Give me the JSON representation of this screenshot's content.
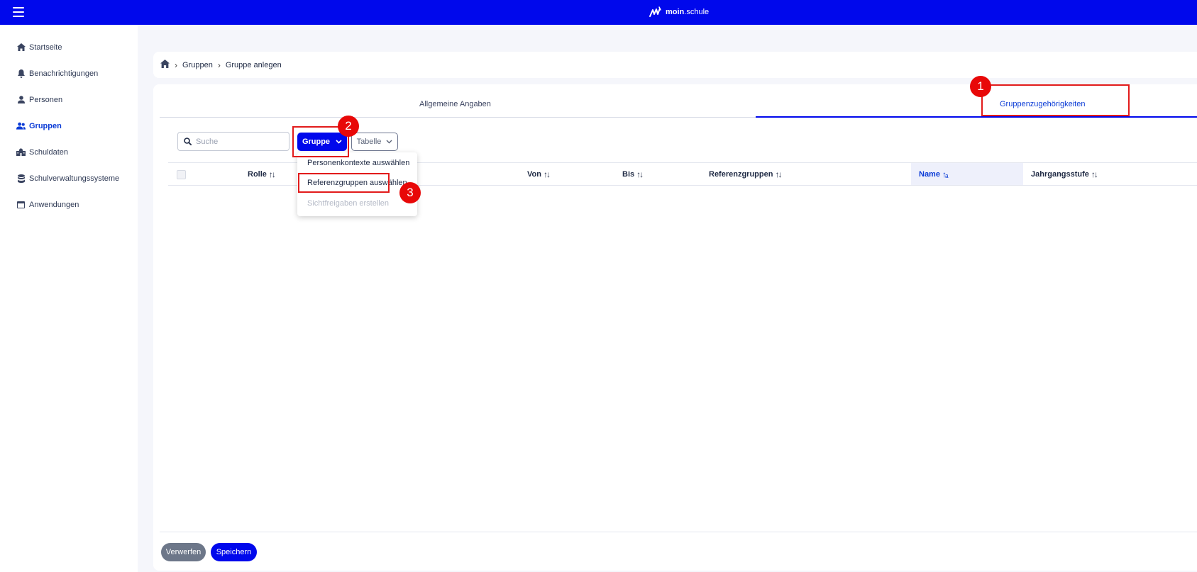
{
  "header": {
    "brand_bold": "moin",
    "brand_rest": ".schule"
  },
  "sidebar": {
    "items": [
      {
        "label": "Startseite",
        "icon": "home-icon"
      },
      {
        "label": "Benachrichtigungen",
        "icon": "bell-icon"
      },
      {
        "label": "Personen",
        "icon": "person-icon"
      },
      {
        "label": "Gruppen",
        "icon": "group-icon",
        "active": true
      },
      {
        "label": "Schuldaten",
        "icon": "school-icon"
      },
      {
        "label": "Schulverwaltungssysteme",
        "icon": "database-icon"
      },
      {
        "label": "Anwendungen",
        "icon": "app-window-icon"
      }
    ]
  },
  "breadcrumb": {
    "items": [
      "Gruppen",
      "Gruppe anlegen"
    ]
  },
  "tabs": [
    {
      "label": "Allgemeine Angaben"
    },
    {
      "label": "Gruppenzugehörigkeiten",
      "active": true
    }
  ],
  "toolbar": {
    "search_placeholder": "Suche",
    "gruppe_label": "Gruppe",
    "tabelle_label": "Tabelle"
  },
  "table": {
    "columns": [
      "Rolle",
      "Von",
      "Bis",
      "Referenzgruppen",
      "Name",
      "Jahrgangsstufe"
    ],
    "sorted_column": "Name"
  },
  "dropdown": {
    "items": [
      {
        "label": "Personenkontexte auswählen",
        "disabled": false
      },
      {
        "label": "Referenzgruppen auswählen",
        "disabled": false
      },
      {
        "label": "Sichtfreigaben erstellen",
        "disabled": true
      }
    ]
  },
  "footer": {
    "discard_label": "Verwerfen",
    "save_label": "Speichern"
  },
  "annotations": {
    "badges": [
      "1",
      "2",
      "3"
    ],
    "highlight_color": "#e21b1b"
  },
  "colors": {
    "primary": "#0008ec",
    "active_text": "#0a3bd6",
    "secondary_button": "#6d7789"
  }
}
